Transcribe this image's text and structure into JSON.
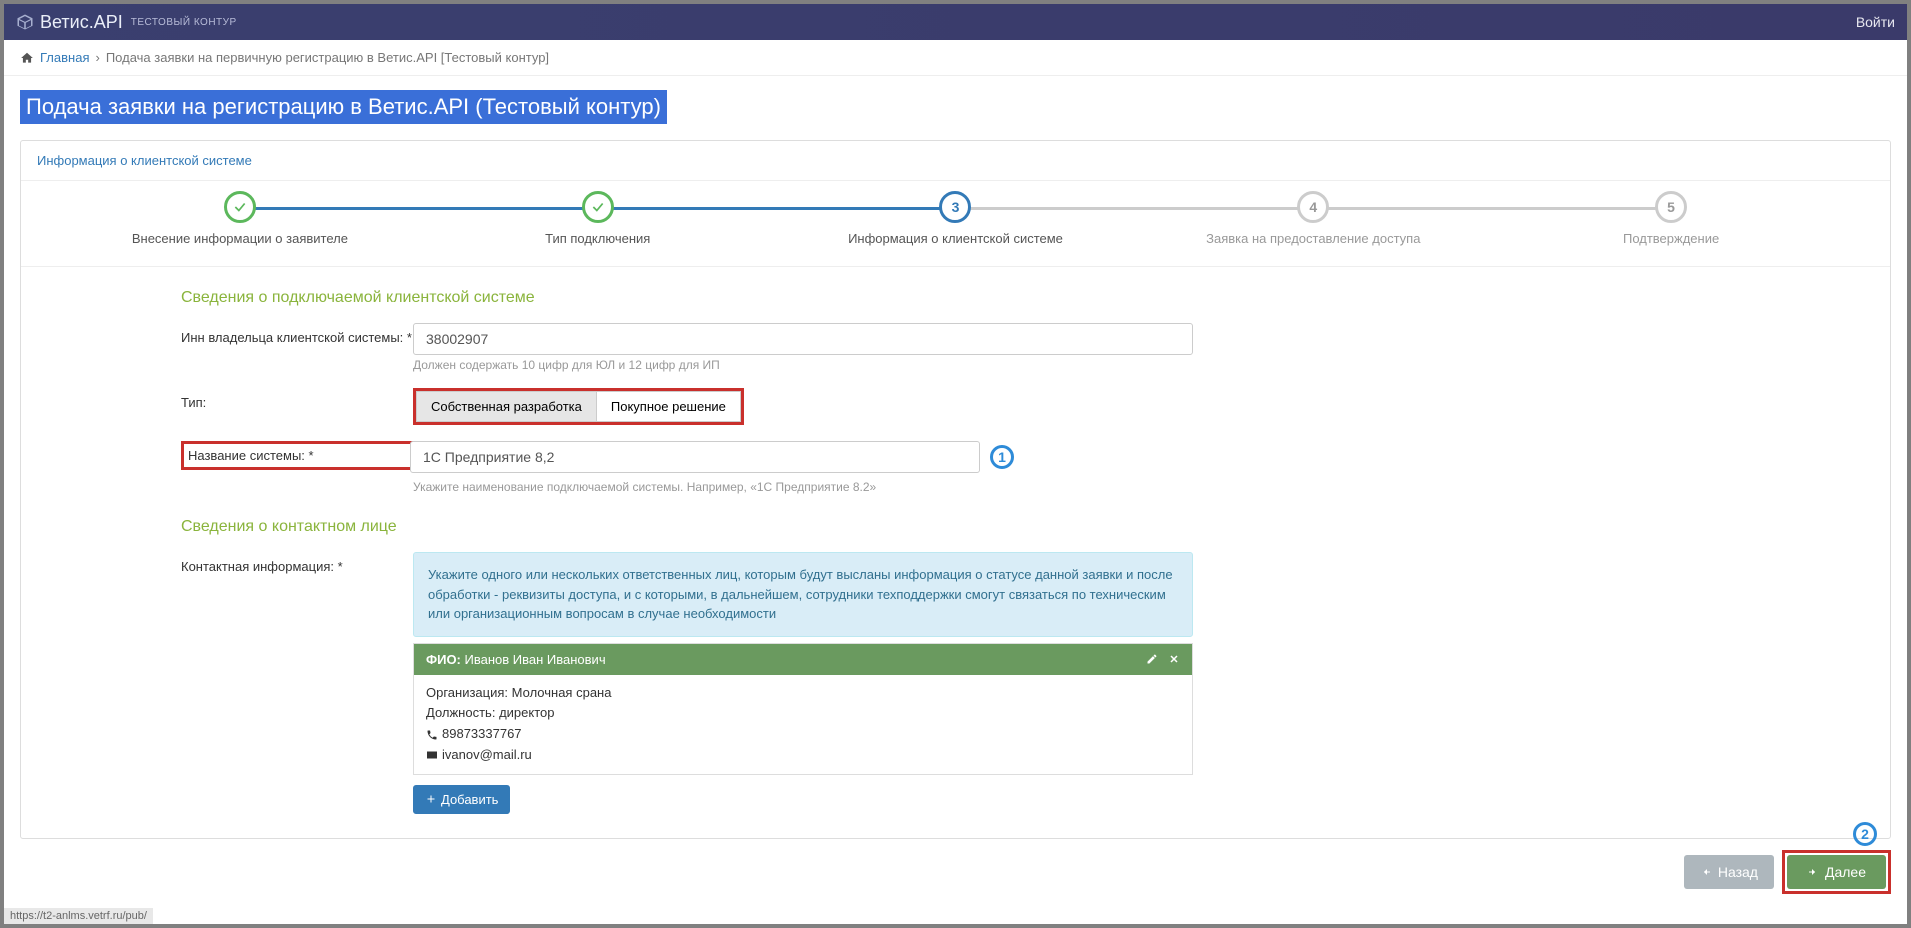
{
  "header": {
    "brand": "Ветис.API",
    "env": "ТЕСТОВЫЙ КОНТУР",
    "login": "Войти"
  },
  "breadcrumb": {
    "home": "Главная",
    "current": "Подача заявки на первичную регистрацию в Ветис.API [Тестовый контур]"
  },
  "page_title": "Подача заявки на регистрацию в Ветис.API (Тестовый контур)",
  "panel_title": "Информация о клиентской системе",
  "steps": [
    {
      "label": "Внесение информации о заявителе",
      "state": "done"
    },
    {
      "label": "Тип подключения",
      "state": "done"
    },
    {
      "label": "Информация о клиентской системе",
      "state": "active",
      "num": "3"
    },
    {
      "label": "Заявка на предоставление доступа",
      "state": "future",
      "num": "4"
    },
    {
      "label": "Подтверждение",
      "state": "future",
      "num": "5"
    }
  ],
  "section1_title": "Сведения о подключаемой клиентской системе",
  "inn": {
    "label": "Инн владельца клиентской системы: *",
    "value": "38002907",
    "hint": "Должен содержать 10 цифр для ЮЛ и 12 цифр для ИП"
  },
  "type": {
    "label": "Тип:",
    "opt1": "Собственная разработка",
    "opt2": "Покупное решение"
  },
  "sysname": {
    "label": "Название системы: *",
    "value": "1С Предприятие 8,2",
    "hint": "Укажите наименование подключаемой системы. Например, «1С Предприятие 8.2»"
  },
  "callout1": "1",
  "section2_title": "Сведения о контактном лице",
  "contact_label": "Контактная информация: *",
  "contact_info_alert": "Укажите одного или нескольких ответственных лиц, которым будут высланы информация о статусе данной заявки и после обработки - реквизиты доступа, и с которыми, в дальнейшем, сотрудники техподдержки смогут связаться по техническим или организационным вопросам в случае необходимости",
  "contact_card": {
    "fio_label": "ФИО:",
    "fio_value": "Иванов Иван Иванович",
    "org_label": "Организация:",
    "org_value": "Молочная срана",
    "pos_label": "Должность:",
    "pos_value": "директор",
    "phone": "89873337767",
    "email": "ivanov@mail.ru"
  },
  "add_button": "Добавить",
  "back_button": "Назад",
  "next_button": "Далее",
  "callout2": "2",
  "status_url": "https://t2-anlms.vetrf.ru/pub/"
}
